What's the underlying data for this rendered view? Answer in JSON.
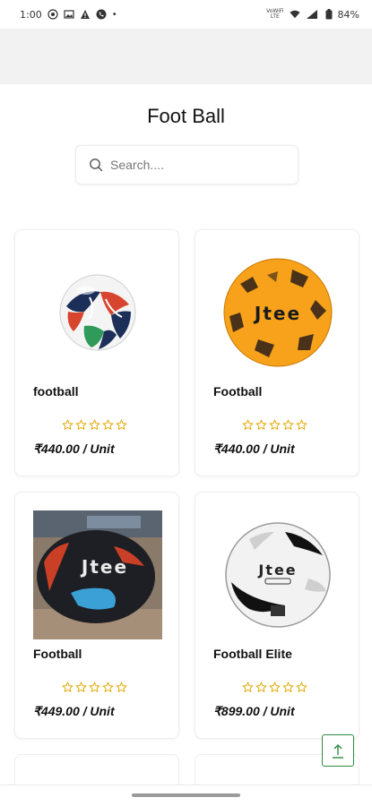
{
  "status_bar": {
    "time": "1:00",
    "network_label_top": "VoWiFi",
    "network_label_bottom": "LTE",
    "lte_label": "LTE",
    "battery": "84%",
    "icons": [
      "whatsapp-icon",
      "image-icon",
      "warning-icon",
      "phone-icon",
      "dot-icon",
      "wifi-icon",
      "signal-icon",
      "battery-icon"
    ]
  },
  "page": {
    "title": "Foot Ball"
  },
  "search": {
    "placeholder": "Search...."
  },
  "products": [
    {
      "name": "football",
      "price": "₹440.00 / Unit",
      "rating": 0,
      "image": "brazuca-ball"
    },
    {
      "name": "Football",
      "price": "₹440.00 / Unit",
      "rating": 0,
      "image": "orange-jtee-ball"
    },
    {
      "name": "Football",
      "price": "₹449.00 / Unit",
      "rating": 0,
      "image": "black-jtee-ball-photo"
    },
    {
      "name": "Football Elite",
      "price": "₹899.00 / Unit",
      "rating": 0,
      "image": "white-jtee-ball"
    }
  ],
  "colors": {
    "star": "#e0a800",
    "scroll_top": "#2e8b3e",
    "header_bg": "#f2f2f2"
  }
}
